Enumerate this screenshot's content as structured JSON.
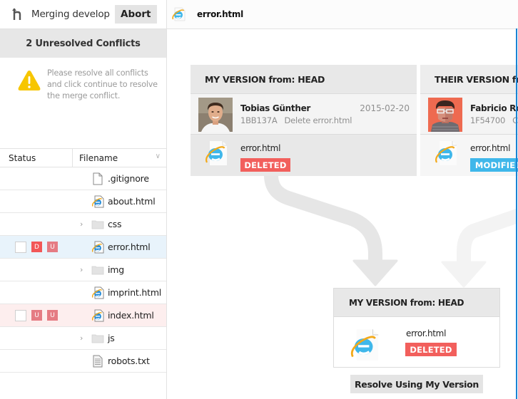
{
  "sidebar": {
    "merge_icon": "merge-branch-icon",
    "merging_label": "Merging develop",
    "abort_label": "Abort",
    "conflicts_title": "2 Unresolved Conflicts",
    "warning_icon": "warning-triangle-icon",
    "warning_text": "Please resolve all conflicts and click continue to resolve the merge conflict.",
    "columns": {
      "status": "Status",
      "filename": "Filename",
      "sort_icon": "chevron-down-icon"
    },
    "files": [
      {
        "name": ".gitignore",
        "type": "text-file",
        "folder": false,
        "badges": [],
        "state": ""
      },
      {
        "name": "about.html",
        "type": "html-file",
        "folder": false,
        "badges": [],
        "state": ""
      },
      {
        "name": "css",
        "type": "folder",
        "folder": true,
        "badges": [],
        "state": ""
      },
      {
        "name": "error.html",
        "type": "html-file",
        "folder": false,
        "badges": [
          "D",
          "U"
        ],
        "state": "selected"
      },
      {
        "name": "img",
        "type": "folder",
        "folder": true,
        "badges": [],
        "state": ""
      },
      {
        "name": "imprint.html",
        "type": "html-file",
        "folder": false,
        "badges": [],
        "state": ""
      },
      {
        "name": "index.html",
        "type": "html-file",
        "folder": false,
        "badges": [
          "U",
          "U"
        ],
        "state": "conflict"
      },
      {
        "name": "js",
        "type": "folder",
        "folder": true,
        "badges": [],
        "state": ""
      },
      {
        "name": "robots.txt",
        "type": "text-lines-file",
        "folder": false,
        "badges": [],
        "state": ""
      }
    ]
  },
  "main": {
    "file_icon": "html-file-icon",
    "title": "error.html",
    "my_version": {
      "heading": "MY VERSION from: HEAD",
      "author": "Tobias Günther",
      "date": "2015-02-20",
      "hash": "1BB137A",
      "message": "Delete error.html",
      "file": "error.html",
      "status": "DELETED"
    },
    "their_version": {
      "heading": "THEIR VERSION from:",
      "author": "Fabricio Ros",
      "hash": "1F54700",
      "message": "Ch",
      "file": "error.html",
      "status": "MODIFIED"
    },
    "result": {
      "heading": "MY VERSION from: HEAD",
      "file": "error.html",
      "status": "DELETED"
    },
    "resolve_label": "Resolve Using My Version"
  },
  "colors": {
    "deleted": "#f25f5c",
    "modified": "#3fb7ea",
    "badge_d": "#f25757",
    "badge_u": "#e57b83",
    "selected_row": "#e8f3fb",
    "conflict_row": "#fdeeee",
    "warning": "#f7c600",
    "scroll_edge": "#1a83d4"
  }
}
